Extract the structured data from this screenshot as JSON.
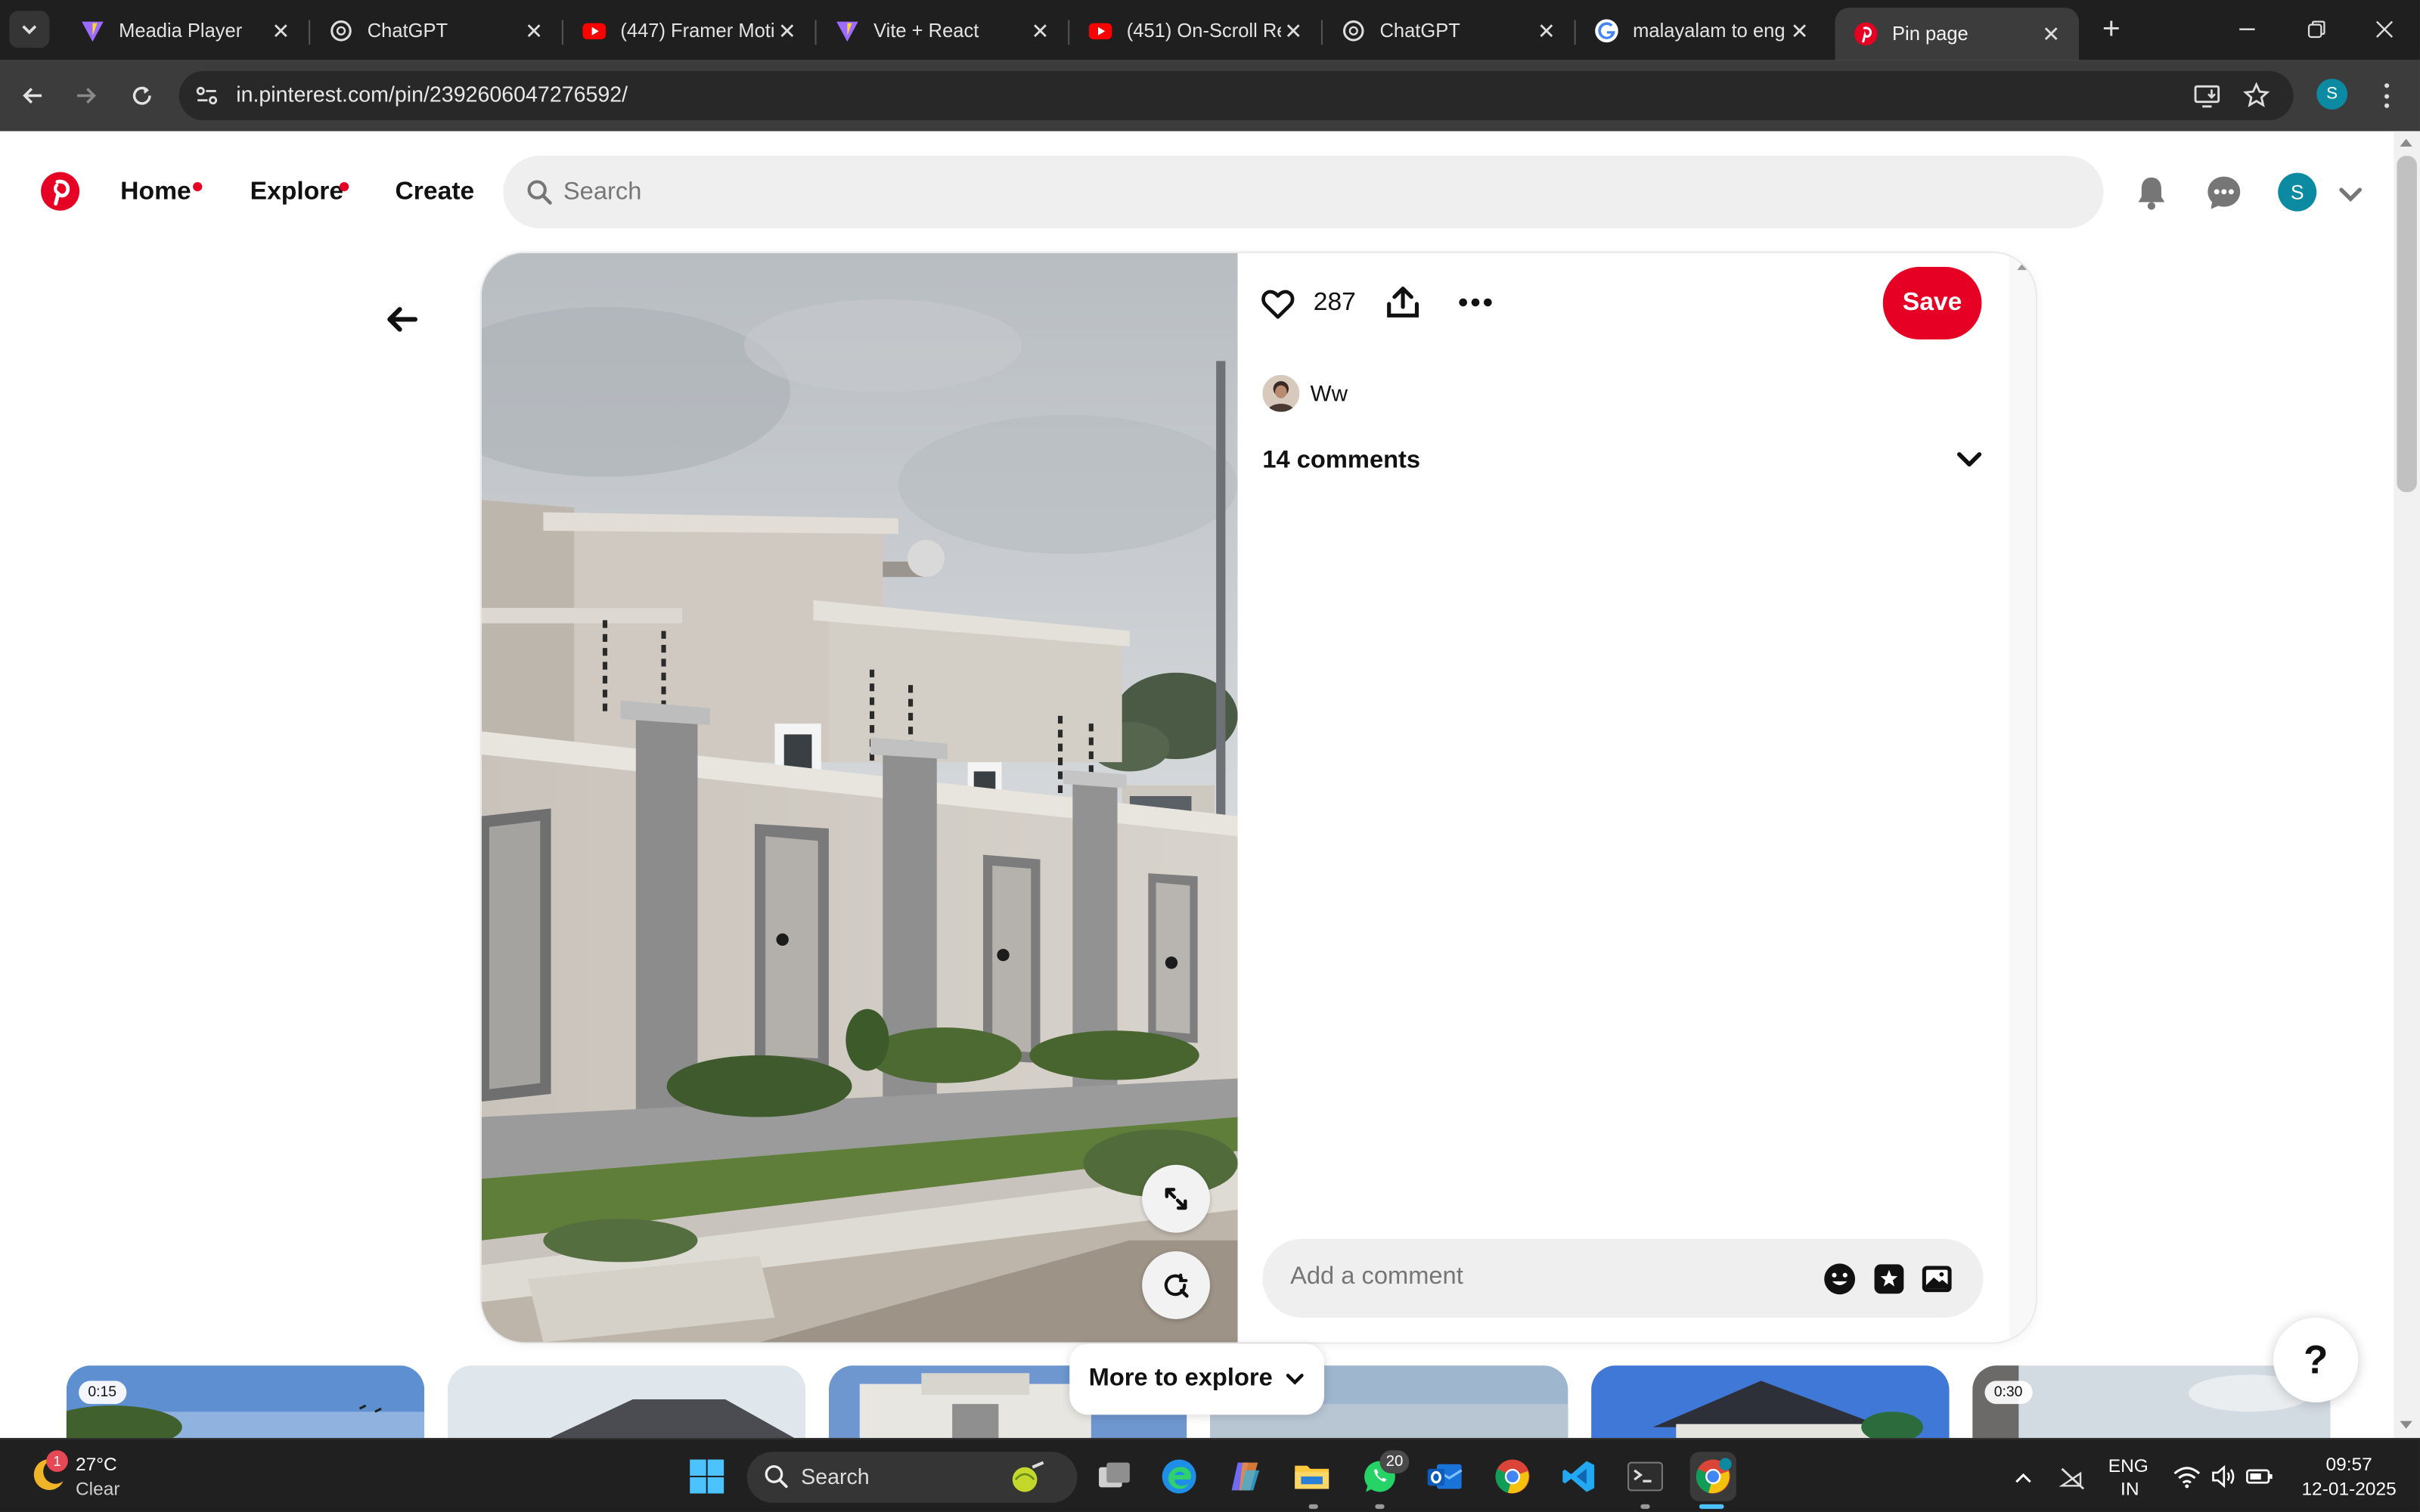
{
  "browser": {
    "tabs": [
      {
        "title": "Meadia Player",
        "icon": "vite-icon",
        "active": false
      },
      {
        "title": "ChatGPT",
        "icon": "chatgpt-icon",
        "active": false
      },
      {
        "title": "(447) Framer Moti",
        "icon": "youtube-icon",
        "active": false
      },
      {
        "title": "Vite + React",
        "icon": "vite-icon",
        "active": false
      },
      {
        "title": "(451) On-Scroll Re",
        "icon": "youtube-icon",
        "active": false
      },
      {
        "title": "ChatGPT",
        "icon": "chatgpt-icon",
        "active": false
      },
      {
        "title": "malayalam to eng",
        "icon": "google-icon",
        "active": false
      },
      {
        "title": "Pin page",
        "icon": "pinterest-icon",
        "active": true
      }
    ],
    "url": "in.pinterest.com/pin/2392606047276592/",
    "profile_initial": "S"
  },
  "pinterest": {
    "nav": {
      "home": "Home",
      "explore": "Explore",
      "create": "Create"
    },
    "search_placeholder": "Search",
    "user_initial": "S",
    "brand_color": "#e60023"
  },
  "pin": {
    "like_count": "287",
    "save_label": "Save",
    "author": "Ww",
    "comments_heading": "14 comments",
    "comment_placeholder": "Add a comment"
  },
  "explore": {
    "more_label": "More to explore",
    "thumbnails": [
      {
        "duration": "0:15"
      },
      {
        "duration": ""
      },
      {
        "duration": ""
      },
      {
        "duration": ""
      },
      {
        "duration": ""
      },
      {
        "duration": "0:30"
      }
    ],
    "help_label": "?"
  },
  "taskbar": {
    "weather_badge": "1",
    "temperature": "27°C",
    "condition": "Clear",
    "search_label": "Search",
    "whatsapp_badge": "20",
    "language_top": "ENG",
    "language_bottom": "IN",
    "time": "09:57",
    "date": "12-01-2025"
  }
}
